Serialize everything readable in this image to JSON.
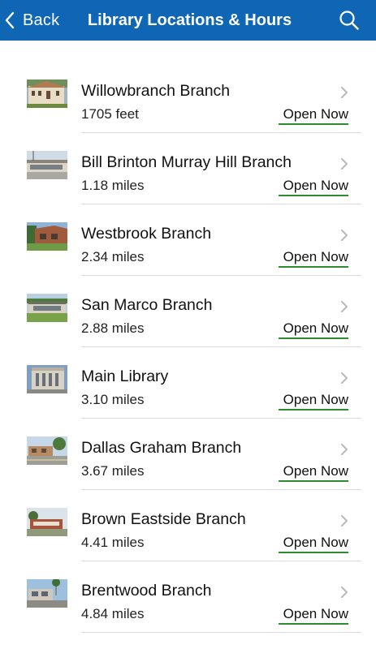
{
  "nav": {
    "back_label": "Back",
    "title": "Library Locations & Hours",
    "back_icon": "chevron-left-icon",
    "search_icon": "search-icon",
    "background": "#0f66b5"
  },
  "status_color": "#2e8b2e",
  "locations": [
    {
      "name": "Willowbranch Branch",
      "distance": "1705 feet",
      "status": "Open Now"
    },
    {
      "name": "Bill Brinton Murray Hill Branch",
      "distance": "1.18 miles",
      "status": "Open Now"
    },
    {
      "name": "Westbrook Branch",
      "distance": "2.34 miles",
      "status": "Open Now"
    },
    {
      "name": "San Marco Branch",
      "distance": "2.88 miles",
      "status": "Open Now"
    },
    {
      "name": "Main Library",
      "distance": "3.10 miles",
      "status": "Open Now"
    },
    {
      "name": "Dallas Graham Branch",
      "distance": "3.67 miles",
      "status": "Open Now"
    },
    {
      "name": "Brown Eastside Branch",
      "distance": "4.41 miles",
      "status": "Open Now"
    },
    {
      "name": "Brentwood Branch",
      "distance": "4.84 miles",
      "status": "Open Now"
    }
  ]
}
